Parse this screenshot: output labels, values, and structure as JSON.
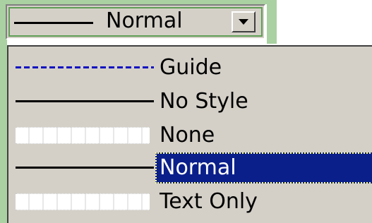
{
  "combo": {
    "selected_label": "Normal"
  },
  "list": {
    "items": [
      {
        "label": "Guide",
        "swatch": "dashed"
      },
      {
        "label": "No Style",
        "swatch": "solid"
      },
      {
        "label": "None",
        "swatch": "dotgrid"
      },
      {
        "label": "Normal",
        "swatch": "solid",
        "selected": true
      },
      {
        "label": "Text Only",
        "swatch": "dotgrid"
      }
    ]
  },
  "colors": {
    "selection": "#0a1f8a",
    "guide_line": "#1010c0",
    "frame": "#d4d0c8",
    "accent_green": "#a9d1a1"
  }
}
